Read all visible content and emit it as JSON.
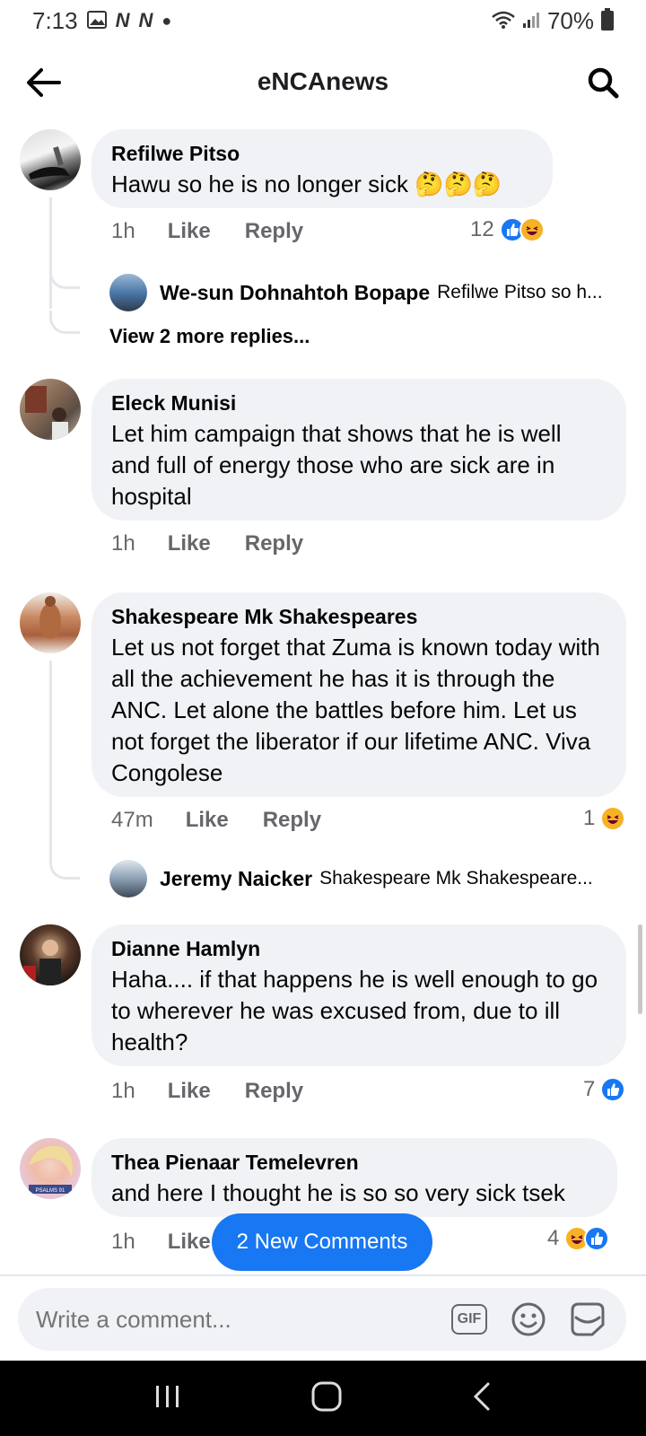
{
  "status_bar": {
    "time": "7:13",
    "notif_icons": [
      "N",
      "N"
    ],
    "battery": "70%"
  },
  "header": {
    "title": "eNCAnews"
  },
  "comments": [
    {
      "name": "Refilwe Pitso",
      "text": "Hawu so he is no longer sick 🤔🤔🤔",
      "time": "1h",
      "like": "Like",
      "reply": "Reply",
      "reaction_count": "12",
      "reactions": [
        "like",
        "haha"
      ],
      "replies": [
        {
          "name": "We-sun Dohnahtoh Bopape",
          "text": "Refilwe Pitso so h..."
        }
      ],
      "view_more": "View 2 more replies..."
    },
    {
      "name": "Eleck Munisi",
      "text": "Let him campaign that shows that he is well and full of energy those who are sick are in hospital",
      "time": "1h",
      "like": "Like",
      "reply": "Reply"
    },
    {
      "name": "Shakespeare Mk Shakespeares",
      "text": "Let us not forget that Zuma is known today with all the achievement he has it is through the ANC. Let alone the battles before him. Let us not forget the liberator if our lifetime ANC. Viva Congolese",
      "time": "47m",
      "like": "Like",
      "reply": "Reply",
      "reaction_count": "1",
      "reactions": [
        "haha"
      ],
      "replies": [
        {
          "name": "Jeremy Naicker",
          "text": "Shakespeare Mk Shakespeare..."
        }
      ]
    },
    {
      "name": "Dianne Hamlyn",
      "text": "Haha.... if that happens he is well enough to go to wherever he was excused from, due to ill health?",
      "time": "1h",
      "like": "Like",
      "reply": "Reply",
      "reaction_count": "7",
      "reactions": [
        "like"
      ]
    },
    {
      "name": "Thea Pienaar Temelevren",
      "text": "and here I thought he is so so very sick tsek",
      "time": "1h",
      "like": "Like",
      "reaction_count": "4",
      "reactions": [
        "haha",
        "like"
      ]
    }
  ],
  "new_comments_pill": "2 New Comments",
  "composer": {
    "placeholder": "Write a comment...",
    "gif_label": "GIF"
  },
  "colors": {
    "accent": "#1877f2",
    "bubble": "#f0f2f5",
    "muted": "#65676b"
  }
}
